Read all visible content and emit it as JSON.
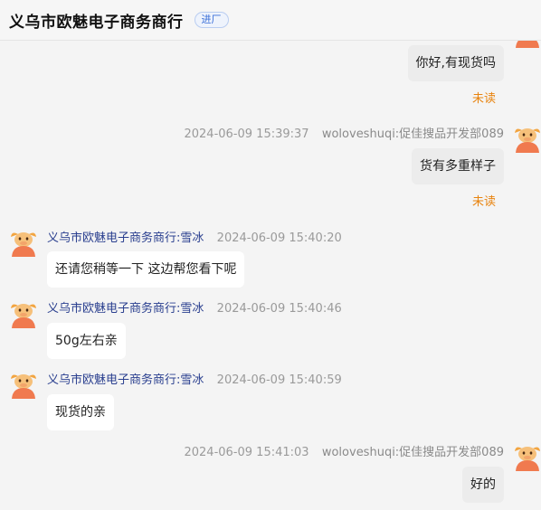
{
  "header": {
    "title": "义乌市欧魅电子商务商行",
    "badge": "进厂"
  },
  "messages": [
    {
      "side": "right",
      "text": "你好,有现货吗",
      "status": "未读"
    },
    {
      "side": "right",
      "timestamp": "2024-06-09 15:39:37",
      "sender": "woloveshuqi:促佳搜品开发部089",
      "text": "货有多重样子",
      "status": "未读"
    },
    {
      "side": "left",
      "sender": "义乌市欧魅电子商务商行:雪冰",
      "timestamp": "2024-06-09 15:40:20",
      "text": "还请您稍等一下 这边帮您看下呢"
    },
    {
      "side": "left",
      "sender": "义乌市欧魅电子商务商行:雪冰",
      "timestamp": "2024-06-09 15:40:46",
      "text": "50g左右亲"
    },
    {
      "side": "left",
      "sender": "义乌市欧魅电子商务商行:雪冰",
      "timestamp": "2024-06-09 15:40:59",
      "text": "现货的亲"
    },
    {
      "side": "right",
      "timestamp": "2024-06-09 15:41:03",
      "sender": "woloveshuqi:促佳搜品开发部089",
      "text": "好的"
    }
  ],
  "colors": {
    "unread": "#e8830e",
    "sender_name": "#2a3f8f",
    "avatar": "#f07a4f"
  },
  "icons": {
    "avatar": "cartoon-bull-avatar-icon"
  }
}
